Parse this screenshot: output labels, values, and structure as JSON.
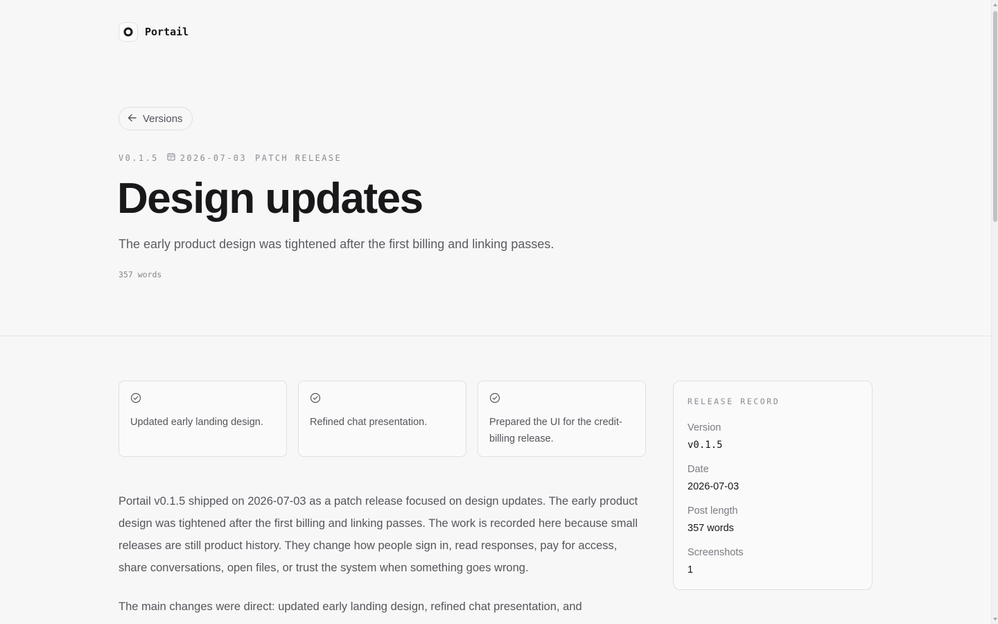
{
  "brand": {
    "name": "Portail",
    "logo_icon": "ring-logo-icon"
  },
  "nav": {
    "back_label": "Versions",
    "back_icon": "arrow-left-icon"
  },
  "release": {
    "version_tag": "V0.1.5",
    "date": "2026-07-03",
    "date_icon": "calendar-icon",
    "kind": "PATCH RELEASE",
    "title": "Design updates",
    "subtitle": "The early product design was tightened after the first billing and linking passes.",
    "word_count": "357 words"
  },
  "highlights": [
    {
      "icon": "check-circle-icon",
      "text": "Updated early landing design."
    },
    {
      "icon": "check-circle-icon",
      "text": "Refined chat presentation."
    },
    {
      "icon": "check-circle-icon",
      "text": "Prepared the UI for the credit-billing release."
    }
  ],
  "article": {
    "paragraphs": [
      "Portail v0.1.5 shipped on 2026-07-03 as a patch release focused on design updates. The early product design was tightened after the first billing and linking passes. The work is recorded here because small releases are still product history. They change how people sign in, read responses, pay for access, share conversations, open files, or trust the system when something goes wrong.",
      "The main changes were direct: updated early landing design, refined chat presentation, and"
    ]
  },
  "record": {
    "heading": "RELEASE RECORD",
    "items": [
      {
        "label": "Version",
        "value": "v0.1.5"
      },
      {
        "label": "Date",
        "value": "2026-07-03"
      },
      {
        "label": "Post length",
        "value": "357 words"
      },
      {
        "label": "Screenshots",
        "value": "1"
      }
    ]
  }
}
